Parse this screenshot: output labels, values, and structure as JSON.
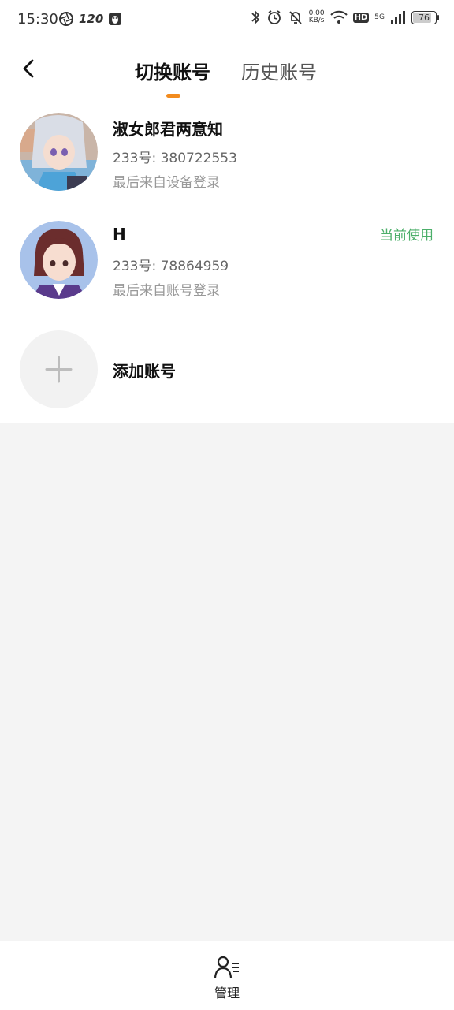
{
  "status_bar": {
    "time": "15:30",
    "refresh_rate": "120",
    "network_speed": "0.00",
    "network_unit": "KB/s",
    "hd": "HD",
    "signal": "5G",
    "battery": "76",
    "battery_level": 0.76
  },
  "header": {
    "active_tab": "切换账号",
    "other_tab": "历史账号"
  },
  "accounts": [
    {
      "name": "淑女郎君两意知",
      "uid": "233号: 380722553",
      "login": "最后来自设备登录",
      "current": ""
    },
    {
      "name": "H",
      "uid": "233号: 78864959",
      "login": "最后来自账号登录",
      "current": "当前使用"
    }
  ],
  "add_account": "添加账号",
  "bottom": {
    "manage_label": "管理"
  },
  "colors": {
    "accent": "#f28b1e",
    "current_green": "#4caf6a",
    "background": "#f4f4f4"
  }
}
